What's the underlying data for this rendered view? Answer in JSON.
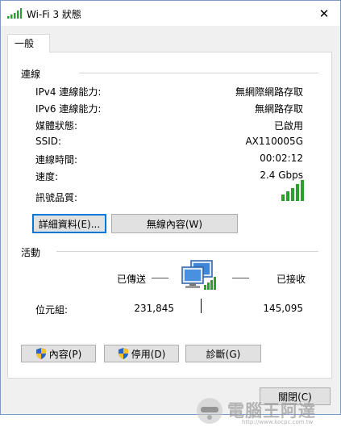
{
  "window": {
    "title": "Wi-Fi 3 狀態",
    "close_symbol": "✕"
  },
  "tabs": [
    {
      "label": "一般"
    }
  ],
  "connection": {
    "header": "連線",
    "rows": [
      {
        "label": "IPv4 連線能力:",
        "value": "無網際網路存取"
      },
      {
        "label": "IPv6 連線能力:",
        "value": "無網路存取"
      },
      {
        "label": "媒體狀態:",
        "value": "已啟用"
      },
      {
        "label": "SSID:",
        "value": "AX110005G"
      },
      {
        "label": "連線時間:",
        "value": "00:02:12"
      },
      {
        "label": "速度:",
        "value": "2.4 Gbps"
      }
    ],
    "signal_label": "訊號品質:",
    "signal_bars": 5,
    "details_button": "詳細資料(E)...",
    "wireless_button": "無線內容(W)"
  },
  "activity": {
    "header": "活動",
    "sent_label": "已傳送",
    "received_label": "已接收",
    "bytes_label": "位元組:",
    "bytes_sent": "231,845",
    "bytes_received": "145,095"
  },
  "buttons": {
    "properties": "內容(P)",
    "disable": "停用(D)",
    "diagnose": "診斷(G)",
    "close": "關閉(C)"
  },
  "watermark": {
    "text": "電腦王阿達",
    "url": "http://www.kocpc.com.tw"
  },
  "colors": {
    "signal_green": "#2ca02c",
    "focus_blue": "#0078d7",
    "shield_blue": "#2a64c8",
    "shield_yellow": "#f2c230"
  }
}
